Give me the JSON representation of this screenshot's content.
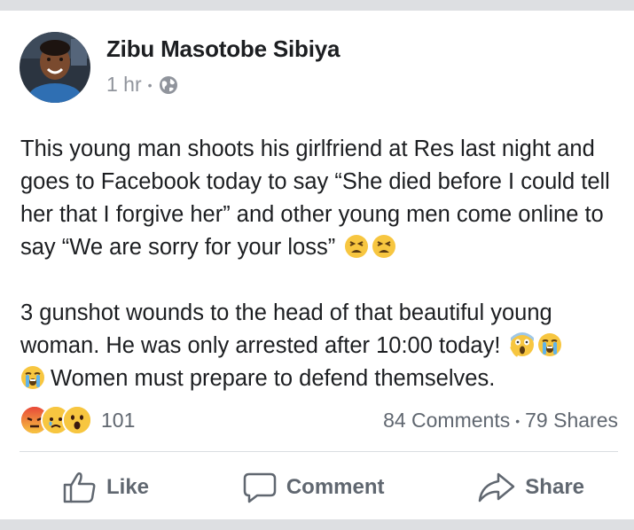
{
  "post": {
    "author": "Zibu Masotobe Sibiya",
    "time": "1 hr",
    "separator": "•",
    "privacy_icon": "globe-icon",
    "paragraphs": [
      "This young man shoots his girlfriend at Res last night and goes to Facebook today to say “She died before I could tell her that I forgive her” and other young men come online to say “We are sorry for your loss”",
      "3 gunshot wounds to the head of that beautiful young woman. He was only arrested after 10:00 today!",
      "Women must prepare to defend themselves."
    ],
    "emoji": [
      "tired-face-emoji",
      "screaming-face-emoji",
      "crying-face-emoji"
    ]
  },
  "stats": {
    "reactions": [
      "angry-reaction",
      "sad-reaction",
      "wow-reaction"
    ],
    "reaction_count": "101",
    "comments": "84 Comments",
    "separator": "•",
    "shares": "79 Shares"
  },
  "actions": {
    "like": "Like",
    "comment": "Comment",
    "share": "Share"
  },
  "colors": {
    "text": "#1c1e21",
    "muted": "#606770",
    "meta": "#90949c",
    "background": "#dddfe2",
    "card": "#ffffff"
  }
}
